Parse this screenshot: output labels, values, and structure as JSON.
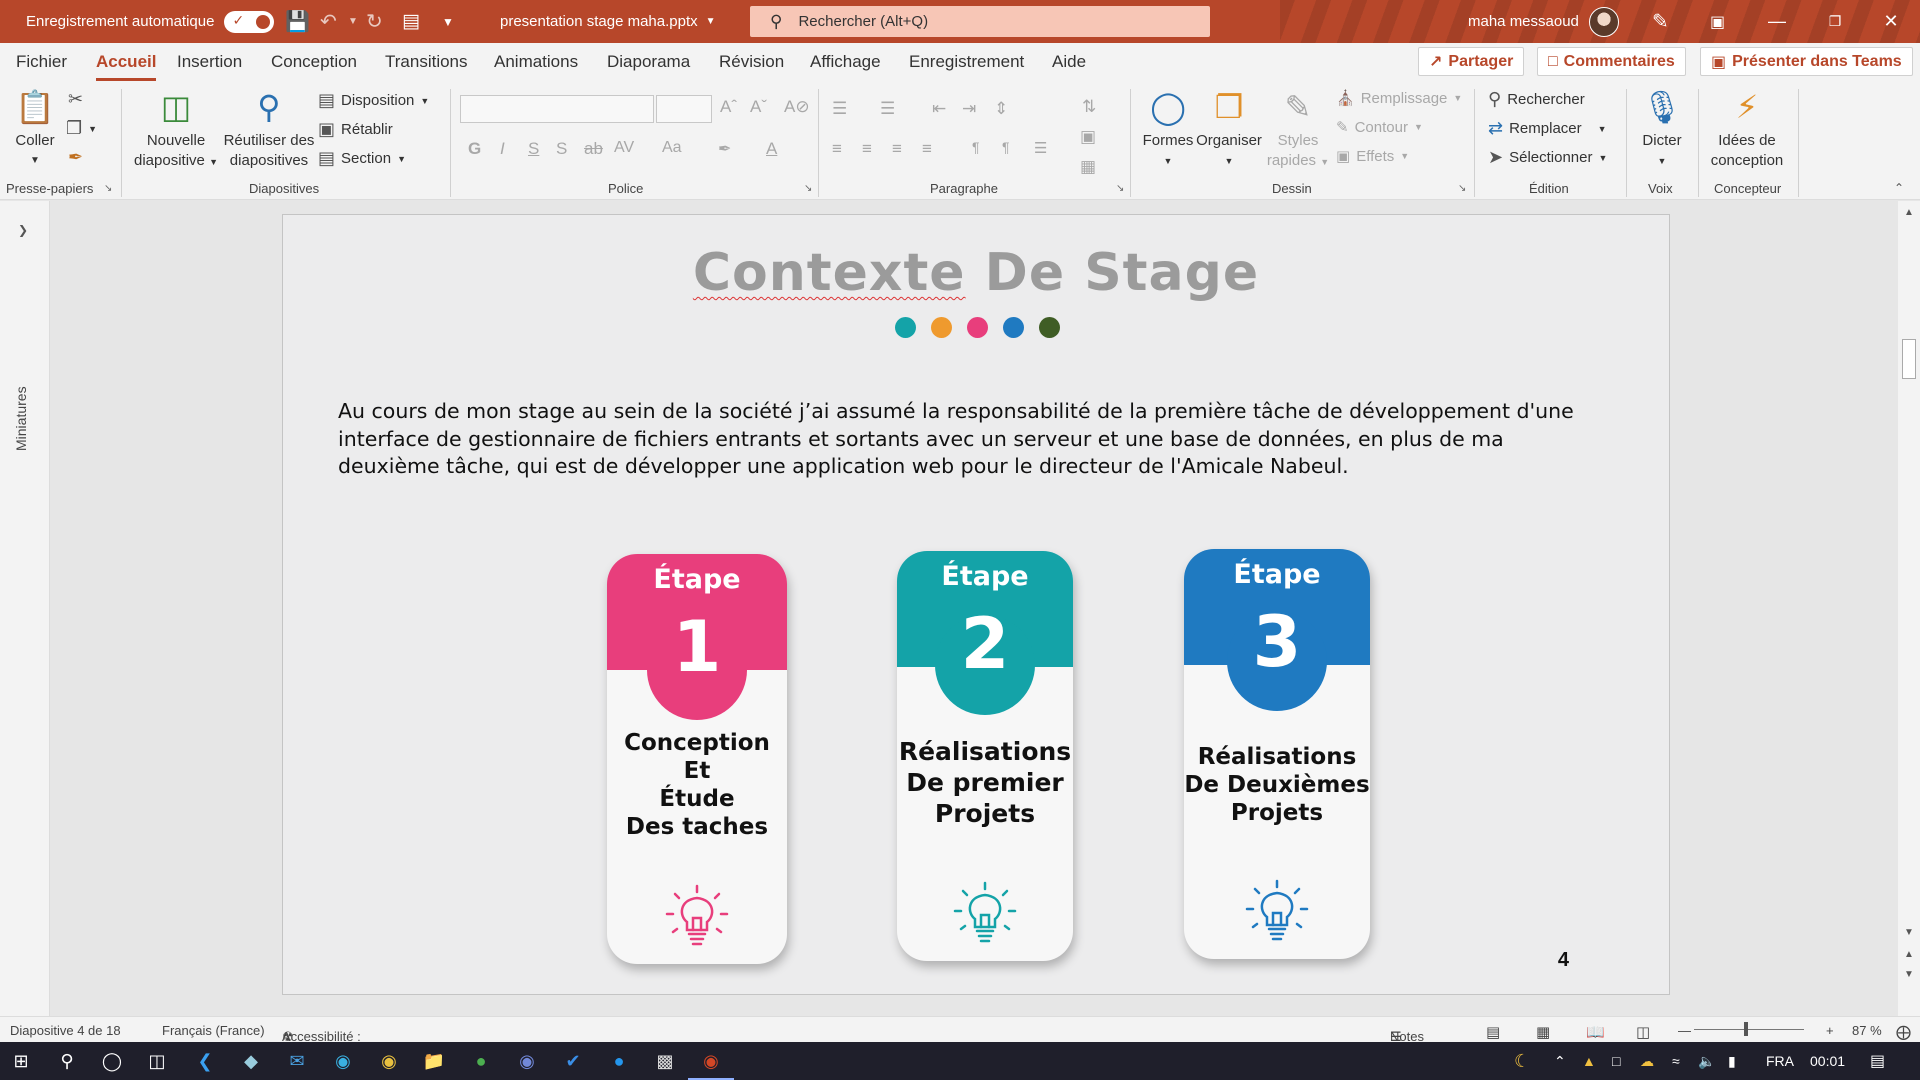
{
  "titlebar": {
    "autosave_label": "Enregistrement automatique",
    "filename": "presentation stage maha.pptx",
    "search_placeholder": "Rechercher (Alt+Q)",
    "user_name": "maha messaoud"
  },
  "menu": {
    "items": [
      "Fichier",
      "Accueil",
      "Insertion",
      "Conception",
      "Transitions",
      "Animations",
      "Diaporama",
      "Révision",
      "Affichage",
      "Enregistrement",
      "Aide"
    ],
    "active": "Accueil",
    "share": "Partager",
    "comments": "Commentaires",
    "teams": "Présenter dans Teams"
  },
  "ribbon": {
    "coller": "Coller",
    "nouvelle_1": "Nouvelle",
    "nouvelle_2": "diapositive",
    "reutiliser_1": "Réutiliser des",
    "reutiliser_2": "diapositives",
    "disposition": "Disposition",
    "retablir": "Rétablir",
    "section": "Section",
    "formes": "Formes",
    "organiser": "Organiser",
    "styles_1": "Styles",
    "styles_2": "rapides",
    "remplissage": "Remplissage",
    "contour": "Contour",
    "effets": "Effets",
    "rechercher": "Rechercher",
    "remplacer": "Remplacer",
    "selectionner": "Sélectionner",
    "dicter": "Dicter",
    "idees_1": "Idées de",
    "idees_2": "conception",
    "groups": {
      "presse": "Presse-papiers",
      "diapositives": "Diapositives",
      "police": "Police",
      "paragraphe": "Paragraphe",
      "dessin": "Dessin",
      "edition": "Édition",
      "voix": "Voix",
      "concepteur": "Concepteur"
    }
  },
  "left_pane": {
    "label": "Miniatures"
  },
  "slide": {
    "title_part1": "Contexte",
    "title_part2": " De Stage",
    "dot_colors": [
      "#14a3a8",
      "#ef9a2e",
      "#e83e7c",
      "#1f7ac1",
      "#3f5d25"
    ],
    "paragraph": "Au cours de mon stage au sein de la société j’ai assumé la responsabilité de la première tâche de développement d'une interface de gestionnaire de fichiers entrants et sortants avec un serveur et une base de données, en plus de ma deuxième tâche, qui est de développer une application web pour le directeur de l'Amicale Nabeul.",
    "cards": [
      {
        "label": "Étape",
        "number": "1",
        "text": "Conception\nEt\nÉtude\nDes taches",
        "color": "#e83e7c",
        "icon": "lightbulb-icon"
      },
      {
        "label": "Étape",
        "number": "2",
        "text": "Réalisations\nDe premier\nProjets",
        "color": "#14a3a8",
        "icon": "lightbulb-icon"
      },
      {
        "label": "Étape",
        "number": "3",
        "text": "Réalisations\nDe Deuxièmes\nProjets",
        "color": "#1f7ac1",
        "icon": "lightbulb-icon"
      }
    ],
    "page_number": "4"
  },
  "status": {
    "slide_info": "Diapositive 4 de 18",
    "language": "Français (France)",
    "accessibility": "Accessibilité : consultez nos recommandations",
    "notes": "Notes",
    "zoom": "87 %"
  },
  "taskbar": {
    "lang": "FRA",
    "time": "00:01"
  }
}
